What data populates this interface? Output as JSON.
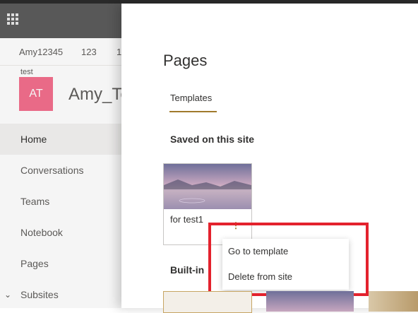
{
  "suite_bar": {
    "waffle_icon": "waffle-icon"
  },
  "breadcrumbs": [
    "Amy12345",
    "123",
    "1"
  ],
  "site": {
    "small_label": "test",
    "avatar_initials": "AT",
    "title": "Amy_Te"
  },
  "nav": {
    "items": [
      {
        "label": "Home"
      },
      {
        "label": "Conversations"
      },
      {
        "label": "Teams"
      },
      {
        "label": "Notebook"
      },
      {
        "label": "Pages"
      },
      {
        "label": "Subsites"
      }
    ],
    "active": "Home"
  },
  "panel": {
    "title": "Pages",
    "tab_templates": "Templates",
    "saved_heading": "Saved on this site",
    "builtin_heading": "Built-in",
    "card": {
      "label": "for test1",
      "more_glyph": "⋮"
    },
    "menu": {
      "go_to_template": "Go to template",
      "delete_from_site": "Delete from site"
    }
  },
  "colors": {
    "accent": "#a07a2c",
    "avatar": "#f36f8d",
    "highlight": "#e3222d"
  }
}
